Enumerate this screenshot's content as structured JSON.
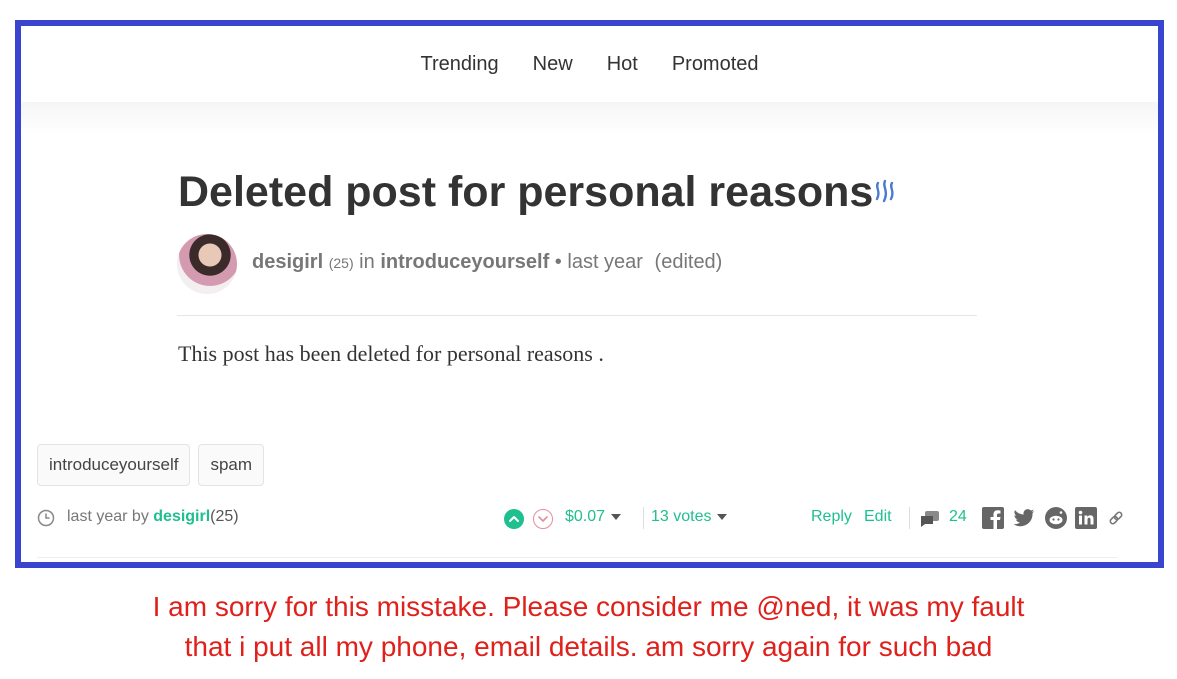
{
  "nav": {
    "items": [
      "Trending",
      "New",
      "Hot",
      "Promoted"
    ]
  },
  "post": {
    "title": "Deleted post for personal reasons",
    "author": "desigirl",
    "reputation": "(25)",
    "in_label": "in",
    "community": "introduceyourself",
    "bullet": "•",
    "time": "last year",
    "edited": "(edited)",
    "body": "This post has been deleted for personal reasons ."
  },
  "tags": [
    "introduceyourself",
    "spam"
  ],
  "footer": {
    "meta_prefix": "last year by",
    "author": "desigirl",
    "reputation": "(25)",
    "payout": "$0.07",
    "votes": "13 votes",
    "reply": "Reply",
    "edit": "Edit",
    "comments_count": "24"
  },
  "caption": {
    "line1": "I am sorry for this misstake. Please consider me @ned, it was my fault",
    "line2": "that i put all my phone, email details. am sorry again for such bad"
  },
  "colors": {
    "frame": "#3a45cf",
    "accent": "#1fbf8f",
    "caption": "#e0201b",
    "downvote": "#e58e9b"
  },
  "icons": [
    "steem-icon",
    "clock-icon",
    "upvote-icon",
    "downvote-icon",
    "comments-icon",
    "facebook-icon",
    "twitter-icon",
    "reddit-icon",
    "linkedin-icon",
    "link-icon"
  ]
}
